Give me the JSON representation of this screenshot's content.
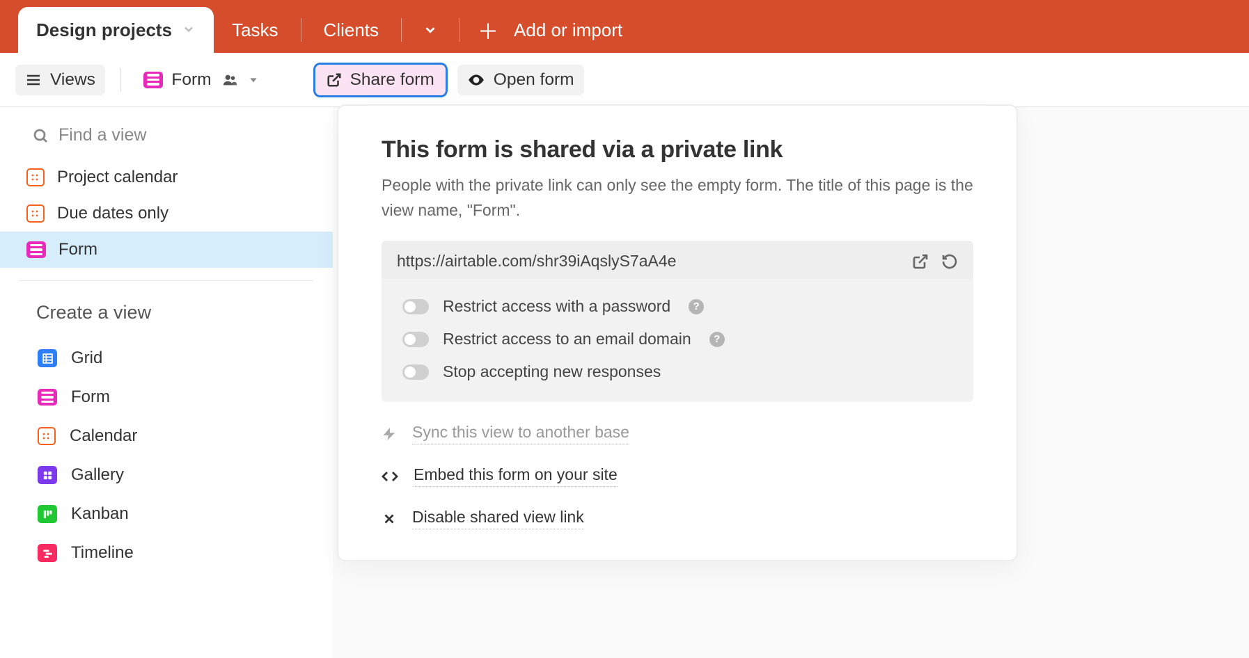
{
  "topTabs": {
    "active": "Design projects",
    "t1": "Tasks",
    "t2": "Clients",
    "add": "Add or import"
  },
  "toolbar": {
    "views": "Views",
    "form": "Form",
    "share": "Share form",
    "open": "Open form"
  },
  "sidebar": {
    "searchPlaceholder": "Find a view",
    "views": {
      "v0": "Project calendar",
      "v1": "Due dates only",
      "v2": "Form"
    },
    "createHeader": "Create a view",
    "create": {
      "c0": "Grid",
      "c1": "Form",
      "c2": "Calendar",
      "c3": "Gallery",
      "c4": "Kanban",
      "c5": "Timeline"
    }
  },
  "popover": {
    "title": "This form is shared via a private link",
    "subtitle": "People with the private link can only see the empty form. The title of this page is the view name, \"Form\".",
    "url": "https://airtable.com/shr39iAqslyS7aA4e",
    "opts": {
      "o0": "Restrict access with a password",
      "o1": "Restrict access to an email domain",
      "o2": "Stop accepting new responses"
    },
    "links": {
      "l0": "Sync this view to another base",
      "l1": "Embed this form on your site",
      "l2": "Disable shared view link"
    }
  }
}
